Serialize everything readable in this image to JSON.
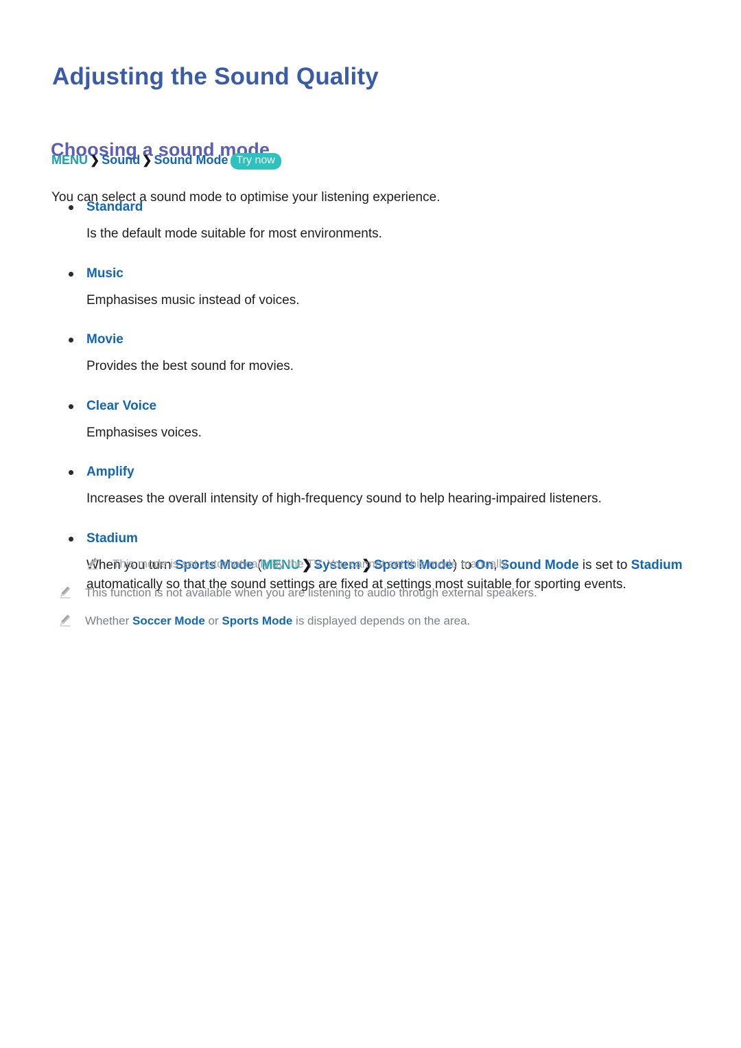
{
  "document": {
    "title": "Adjusting the Sound Quality",
    "section_heading": "Choosing a sound mode",
    "intro": "You can select a sound mode to optimise your listening experience."
  },
  "breadcrumb": {
    "menu": "MENU",
    "separator": "❯",
    "level2": "Sound",
    "level3": "Sound Mode",
    "try_now_badge": "Try now"
  },
  "modes": [
    {
      "label": "Standard",
      "description": "Is the default mode suitable for most environments."
    },
    {
      "label": "Music",
      "description": "Emphasises music instead of voices."
    },
    {
      "label": "Movie",
      "description": "Provides the best sound for movies."
    },
    {
      "label": "Clear Voice",
      "description": "Emphasises voices."
    },
    {
      "label": "Amplify",
      "description": "Increases the overall intensity of high-frequency sound to help hearing-impaired listeners."
    },
    {
      "label": "Stadium",
      "description": "When you turn Sports Mode (MENU ❯ System ❯ Sports Mode) to On, Sound Mode is set to Stadium automatically so that the sound settings are fixed at settings most suitable for sporting events."
    }
  ],
  "stadium_paragraph": {
    "p1": "When you turn ",
    "sports_mode_1": "Sports Mode",
    "p2": " (",
    "menu": "MENU",
    "sep1": "❯",
    "system": "System",
    "sep2": "❯",
    "sports_mode_2": "Sports Mode",
    "p3": ") to ",
    "on": "On",
    "p4": ", ",
    "sound_mode": "Sound Mode",
    "p5": " is set to ",
    "stadium": "Stadium",
    "p6": " automatically so that the sound settings are fixed at settings most suitable for sporting events."
  },
  "notes": [
    {
      "icon": "pencil-icon",
      "indented": true,
      "text": "This mode is set automatically by the TV. You cannot set this mode manually."
    },
    {
      "icon": "pencil-icon",
      "indented": false,
      "text": "This function is not available when you are listening to audio through external speakers."
    },
    {
      "icon": "pencil-icon",
      "indented": false,
      "text_before": "Whether ",
      "term1": "Soccer Mode",
      "text_middle": " or ",
      "term2": "Sports Mode",
      "text_after": " is displayed depends on the area."
    }
  ],
  "colors": {
    "title_blue": "#3a5ca8",
    "heading_purple": "#5a5fb5",
    "link_blue": "#1266b5",
    "menu_teal": "#19a0a8",
    "badge_teal": "#2dc2bd",
    "body_text": "#1d1d1d",
    "note_gray": "#7c8086"
  }
}
